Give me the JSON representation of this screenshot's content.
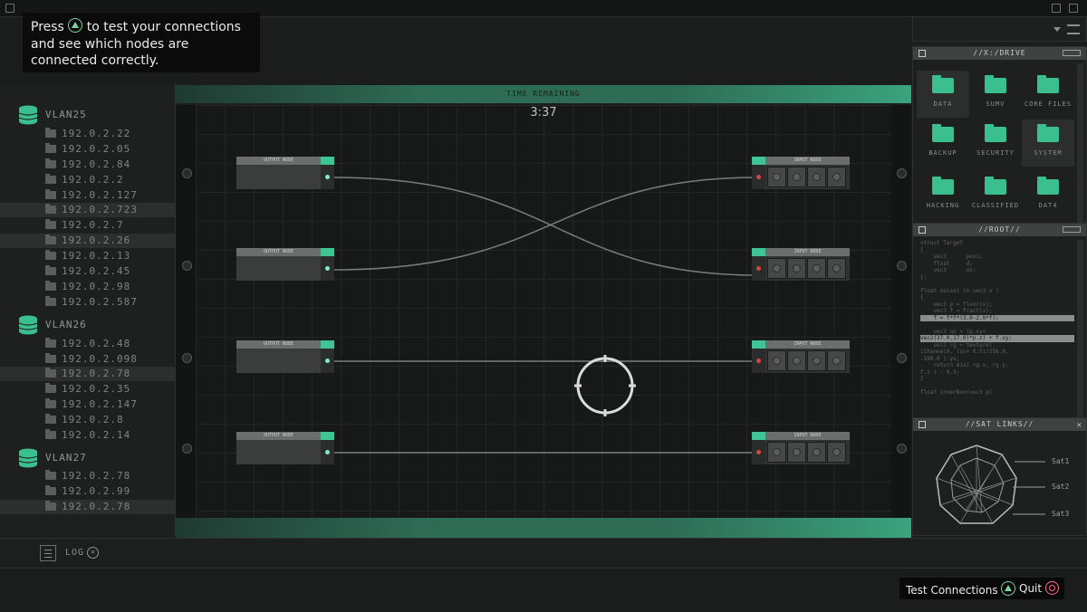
{
  "hint": {
    "prefix": "Press",
    "suffix": "to test your connections and see which nodes are connected correctly."
  },
  "vlans": [
    {
      "name": "VLAN25",
      "ips": [
        "192.0.2.22",
        "192.0.2.05",
        "192.0.2.84",
        "192.0.2.2",
        "192.0.2.127",
        "192.0.2.723",
        "192.0.2.7",
        "192.0.2.26",
        "192.0.2.13",
        "192.0.2.45",
        "192.0.2.98",
        "192.0.2.587"
      ]
    },
    {
      "name": "VLAN26",
      "ips": [
        "192.0.2.48",
        "192.0.2.098",
        "192.0.2.78",
        "192.0.2.35",
        "192.0.2.147",
        "192.0.2.8",
        "192.0.2.14"
      ]
    },
    {
      "name": "VLAN27",
      "ips": [
        "192.0.2.78",
        "192.0.2.99",
        "192.0.2.78"
      ]
    }
  ],
  "board": {
    "header": "TIME REMAINING",
    "timer": "3:37",
    "output_label": "OUTPUT NODE",
    "input_label": "INPUT NODE"
  },
  "drive": {
    "title": "//X:/DRIVE",
    "folders": [
      "DATA",
      "SUMV",
      "CORE FILES",
      "BACKUP",
      "SECURITY",
      "SYSTEM",
      "HACKING",
      "CLASSIFIED",
      "DAT4"
    ]
  },
  "root": {
    "title": "//ROOT//",
    "code_lines": [
      "struct Target",
      "{",
      "    vec3      posi;",
      "    float     d;",
      "    vec3      uv;",
      "};",
      "",
      "float noise( in vec3 x )",
      "{",
      "    vec3 p = floor(x);",
      "    vec3 f = fract(x);",
      "    f = f*f*(3.0-2.0*f);",
      "",
      "    vec2 uv = (p.xy+",
      "vec2(37.0,17.0)*p.z) + f.xy;",
      "    vec2 rg = texture(",
      "iChannel0, (uv+ 0.5)/256.0,",
      "-100.0 ).yx;",
      "    return mix( rg.x, rg.y,",
      "f.z ) - 0.5;",
      "}",
      "",
      "float innerBox(vec3 p)"
    ]
  },
  "sat": {
    "title": "//SAT LINKS//",
    "links": [
      "Sat1",
      "Sat2",
      "Sat3"
    ]
  },
  "log": {
    "label": "LOG"
  },
  "buttons": {
    "test": "Test Connections",
    "quit": "Quit"
  },
  "colors": {
    "accent": "#3ec495",
    "error": "#e04040",
    "ok": "#7df0b8"
  }
}
